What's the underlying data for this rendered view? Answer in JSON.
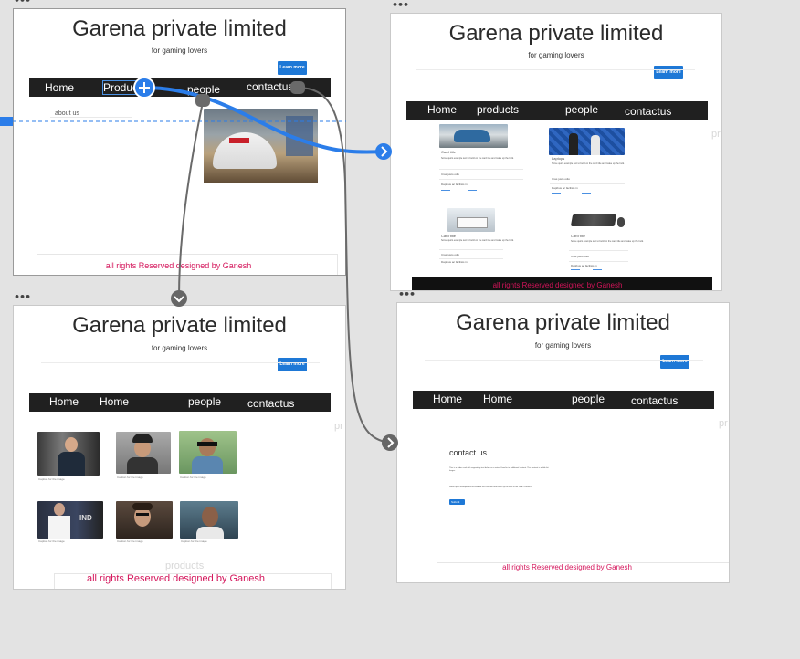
{
  "screens": {
    "home": {
      "title": "Garena private limited",
      "tagline": "for gaming lovers",
      "learn_more": "Learn more",
      "nav": [
        "Home",
        "Products",
        "people",
        "contactus"
      ],
      "about": "about us",
      "footer": "all rights Reserved designed by Ganesh"
    },
    "products": {
      "title": "Garena private limited",
      "tagline": "for gaming lovers",
      "learn_more": "Learn more",
      "nav": [
        "Home",
        "products",
        "people",
        "contactus"
      ],
      "ghost": "pr",
      "footer": "all rights Reserved designed by Ganesh",
      "card_title": "Card title",
      "card_title_2": "Laptops",
      "card_text": "Some quick example text to build on the card title and make up the bulk.",
      "card_line": "Cras justo odio",
      "card_line2": "Dapibus ac facilisis in",
      "card_link1": "Card link",
      "card_link2": "Another link"
    },
    "people": {
      "title": "Garena private limited",
      "tagline": "for gaming lovers",
      "learn_more": "Learn more",
      "nav": [
        "Home",
        "Home",
        "people",
        "contactus"
      ],
      "ghost": "pr",
      "ghost_products": "products",
      "footer": "all rights Reserved designed by Ganesh",
      "caption": "Caption for the image"
    },
    "contact": {
      "title": "Garena private limited",
      "tagline": "for gaming lovers",
      "learn_more": "Learn more",
      "nav": [
        "Home",
        "Home",
        "people",
        "contactus"
      ],
      "ghost": "pr",
      "heading": "contact us",
      "line1": "This is a wider card with supporting text below as a natural lead-in to additional content. This content is a little bit longer.",
      "line2": "Some quick example text to build on the card title and make up the bulk of the card's content.",
      "button": "Submit",
      "footer": "all rights Reserved designed by Ganesh"
    }
  },
  "colors": {
    "canvas": "#e3e3e3",
    "nav": "#202020",
    "accent": "#1e78d6",
    "footer": "#d4145a",
    "wire": "#666666"
  },
  "icons": [
    "plus-icon",
    "chevron-right-icon",
    "chevron-down-icon",
    "more-options-icon"
  ]
}
